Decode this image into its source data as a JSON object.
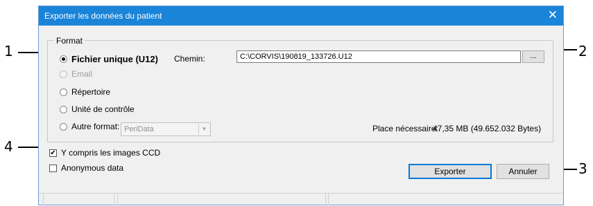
{
  "dialog": {
    "title": "Exporter les données du patient",
    "close_glyph": "✕",
    "format_group_label": "Format",
    "radios": [
      {
        "label": "Fichier unique (U12)",
        "checked": true,
        "disabled": false
      },
      {
        "label": "Email",
        "checked": false,
        "disabled": true
      },
      {
        "label": "Répertoire",
        "checked": false,
        "disabled": false
      },
      {
        "label": "Unité de contrôle",
        "checked": false,
        "disabled": false
      },
      {
        "label": "Autre format:",
        "checked": false,
        "disabled": false
      }
    ],
    "path_label": "Chemin:",
    "path_value": "C:\\CORVIS\\190819_133726.U12",
    "browse_label": "...",
    "other_format_value": "PeriData",
    "dropdown_arrow": "▼",
    "space_label": "Place nécessaire:",
    "space_value": "47,35 MB (49.652.032 Bytes)",
    "include_ccd_label": "Y compris les images CCD",
    "include_ccd_checked": true,
    "anonymous_label": "Anonymous data",
    "anonymous_checked": false,
    "export_button": "Exporter",
    "cancel_button": "Annuler",
    "check_glyph": "✔"
  },
  "callouts": {
    "c1": "1",
    "c2": "2",
    "c3": "3",
    "c4": "4"
  }
}
